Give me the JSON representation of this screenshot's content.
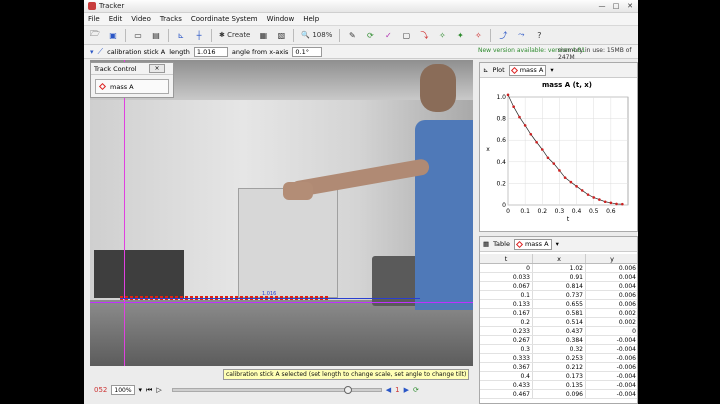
{
  "window": {
    "title": "Tracker",
    "minimize": "—",
    "maximize": "□",
    "close": "✕"
  },
  "menu": [
    "File",
    "Edit",
    "Video",
    "Tracks",
    "Coordinate System",
    "Window",
    "Help"
  ],
  "toolbar": {
    "create_label": "Create",
    "zoom_label": "108%"
  },
  "calibration": {
    "track_label": "calibration stick A",
    "length_label": "length",
    "length_value": "1.016",
    "angle_label": "angle from x-axis",
    "angle_value": "0.1°"
  },
  "notice": {
    "new_version": "New version available: version 4.81",
    "memory": "memory in use: 15MB of 247M"
  },
  "track_control": {
    "title": "Track Control",
    "track_name": "mass A"
  },
  "video_overlay": {
    "calstick_label": "1.016"
  },
  "status_message": "calibration stick A selected (set length to change scale, set angle to change tilt)",
  "player": {
    "frame": "052",
    "zoom": "100%",
    "step": "1",
    "slider_fraction": 0.85
  },
  "plot": {
    "tab_label": "Plot",
    "track_name": "mass A",
    "title": "mass A (t, x)"
  },
  "table": {
    "tab_label": "Table",
    "track_name": "mass A",
    "columns": [
      "t",
      "x",
      "y"
    ],
    "rows": [
      [
        "0",
        "1.02",
        "0.006"
      ],
      [
        "0.033",
        "0.91",
        "0.004"
      ],
      [
        "0.067",
        "0.814",
        "0.004"
      ],
      [
        "0.1",
        "0.737",
        "0.006"
      ],
      [
        "0.133",
        "0.655",
        "0.006"
      ],
      [
        "0.167",
        "0.581",
        "0.002"
      ],
      [
        "0.2",
        "0.514",
        "0.002"
      ],
      [
        "0.233",
        "0.437",
        "0"
      ],
      [
        "0.267",
        "0.384",
        "-0.004"
      ],
      [
        "0.3",
        "0.32",
        "-0.004"
      ],
      [
        "0.333",
        "0.253",
        "-0.006"
      ],
      [
        "0.367",
        "0.212",
        "-0.006"
      ],
      [
        "0.4",
        "0.173",
        "-0.004"
      ],
      [
        "0.433",
        "0.135",
        "-0.004"
      ],
      [
        "0.467",
        "0.096",
        "-0.004"
      ]
    ]
  },
  "chart_data": {
    "type": "scatter",
    "title": "mass A (t, x)",
    "xlabel": "t",
    "ylabel": "x",
    "xlim": [
      0,
      0.7
    ],
    "ylim": [
      0,
      1.0
    ],
    "xticks": [
      "0",
      "0.1",
      "0.2",
      "0.3",
      "0.4",
      "0.5",
      "0.6"
    ],
    "yticks": [
      "0",
      "0.2",
      "0.4",
      "0.6",
      "0.8",
      "1.0"
    ],
    "x": [
      0,
      0.033,
      0.067,
      0.1,
      0.133,
      0.167,
      0.2,
      0.233,
      0.267,
      0.3,
      0.333,
      0.367,
      0.4,
      0.433,
      0.467,
      0.5,
      0.533,
      0.567,
      0.6,
      0.633,
      0.667
    ],
    "y": [
      1.02,
      0.91,
      0.814,
      0.737,
      0.655,
      0.581,
      0.514,
      0.437,
      0.384,
      0.32,
      0.253,
      0.212,
      0.173,
      0.135,
      0.096,
      0.07,
      0.05,
      0.03,
      0.02,
      0.01,
      0.008
    ],
    "grid": true,
    "point_color": "#cc2222"
  }
}
